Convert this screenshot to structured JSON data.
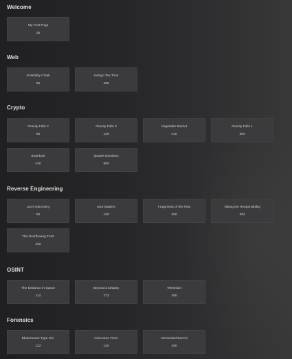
{
  "sections": [
    {
      "title": "Welcome",
      "challenges": [
        {
          "name": "My First Flag!",
          "points": "25"
        }
      ]
    },
    {
      "title": "Web",
      "challenges": [
        {
          "name": "Invisibility Cloak",
          "points": "50"
        },
        {
          "name": "Hologo Tea Time",
          "points": "166"
        }
      ]
    },
    {
      "title": "Crypto",
      "challenges": [
        {
          "name": "Gravity Falls 2",
          "points": "50"
        },
        {
          "name": "Gravity Falls 3",
          "points": "129"
        },
        {
          "name": "Vegetable Market",
          "points": "210"
        },
        {
          "name": "Gravity Falls 1",
          "points": "300"
        },
        {
          "name": "Brainfuck",
          "points": "440"
        },
        {
          "name": "QuanR Numbers",
          "points": "500"
        }
      ]
    },
    {
      "title": "Reverse Engineering",
      "challenges": [
        {
          "name": "Leo's Discovery",
          "points": "50"
        },
        {
          "name": "Size Matters",
          "points": "129"
        },
        {
          "name": "Fragments of the Past",
          "points": "200"
        },
        {
          "name": "Taking the Responsibility",
          "points": "294"
        },
        {
          "name": "The Overflowing Truth",
          "points": "492"
        }
      ]
    },
    {
      "title": "OSINT",
      "challenges": [
        {
          "name": "The Entrance in Space",
          "points": "114"
        },
        {
          "name": "Beyond a Display",
          "points": "273"
        },
        {
          "name": "Television",
          "points": "290"
        }
      ]
    },
    {
      "title": "Forensics",
      "challenges": [
        {
          "name": "Bladerunner Type Shi-",
          "points": "122"
        },
        {
          "name": "Adventure Time!",
          "points": "125"
        },
        {
          "name": "Introverted Bocchi",
          "points": "290"
        }
      ]
    }
  ]
}
